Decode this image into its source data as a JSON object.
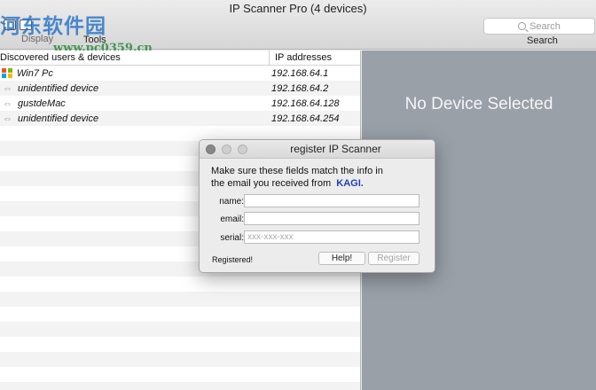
{
  "window": {
    "title": "IP Scanner Pro (4 devices)"
  },
  "toolbar": {
    "display_label": "Display",
    "tools_label": "Tools",
    "search_placeholder": "Search",
    "search_label": "Search",
    "watermark": "河东软件园",
    "watermark_url": "www.pc0359.cn"
  },
  "table": {
    "headers": [
      "Discovered users & devices",
      "IP addresses"
    ],
    "rows": [
      {
        "name": "Win7 Pc",
        "ip": "192.168.64.1",
        "icon": "windows-icon"
      },
      {
        "name": "unidentified device",
        "ip": "192.168.64.2",
        "icon": "network-arrows-icon"
      },
      {
        "name": "gustdeMac",
        "ip": "192.168.64.128",
        "icon": "network-arrows-icon"
      },
      {
        "name": "unidentified device",
        "ip": "192.168.64.254",
        "icon": "network-arrows-icon"
      }
    ]
  },
  "detail": {
    "empty_text": "No Device Selected"
  },
  "dialog": {
    "title": "register IP Scanner",
    "message_line1": "Make sure these fields match the info in",
    "message_line2": "the email you received from",
    "vendor": "KAGI.",
    "name_label": "name:",
    "email_label": "email:",
    "serial_label": "serial:",
    "name_value": "",
    "email_value": "",
    "serial_placeholder": "xxx-xxx-xxx",
    "status": "Registered!",
    "help_button": "Help!",
    "register_button": "Register"
  },
  "colors": {
    "accent_link": "#1f3fbf",
    "pane_bg": "#9aa0a8"
  }
}
